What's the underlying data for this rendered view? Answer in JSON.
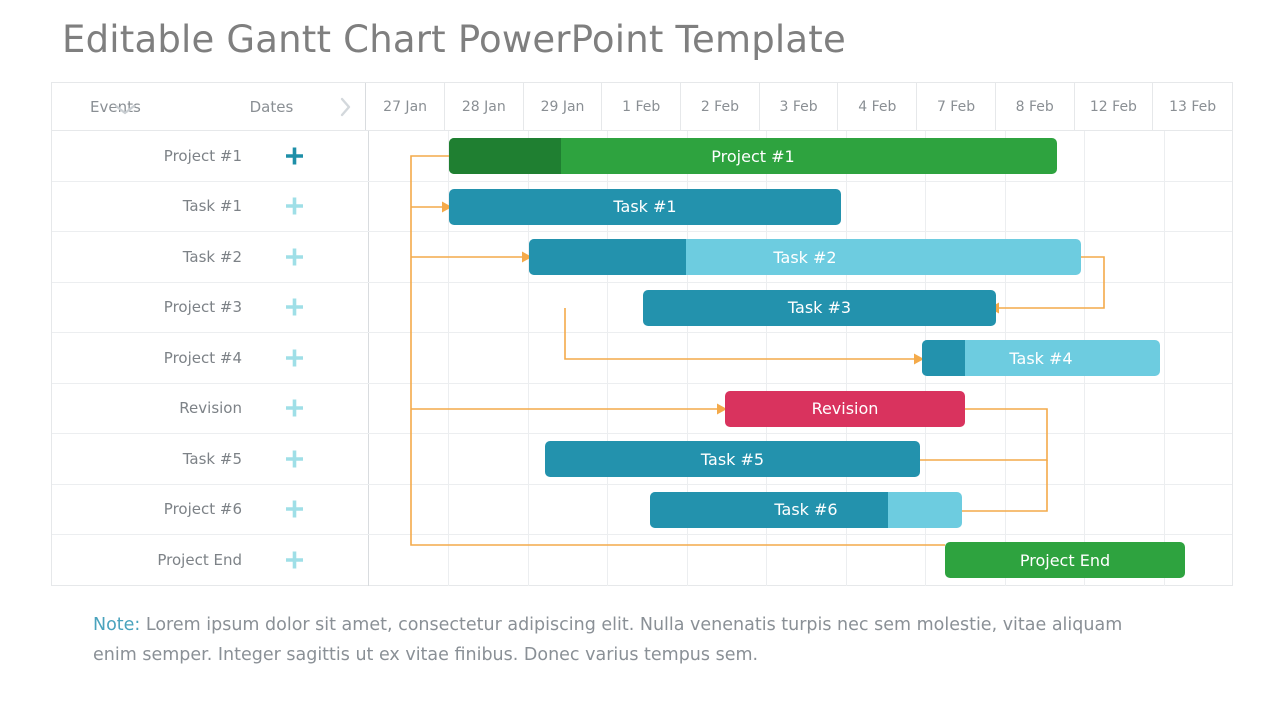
{
  "title": "Editable Gantt Chart PowerPoint Template",
  "header": {
    "events_label": "Events",
    "dates_label": "Dates",
    "collapse_icon": "chevron-down-icon",
    "expand_icon": "chevron-right-icon",
    "dates": [
      "27 Jan",
      "28 Jan",
      "29 Jan",
      "1 Feb",
      "2 Feb",
      "3 Feb",
      "4 Feb",
      "7 Feb",
      "8 Feb",
      "12 Feb",
      "13 Feb"
    ]
  },
  "rows": [
    {
      "event": "Project #1",
      "bar_label": "Project #1"
    },
    {
      "event": "Task #1",
      "bar_label": "Task #1"
    },
    {
      "event": "Task #2",
      "bar_label": "Task #2"
    },
    {
      "event": "Project #3",
      "bar_label": "Task #3"
    },
    {
      "event": "Project #4",
      "bar_label": "Task #4"
    },
    {
      "event": "Revision",
      "bar_label": "Revision"
    },
    {
      "event": "Task #5",
      "bar_label": "Task #5"
    },
    {
      "event": "Project #6",
      "bar_label": "Task #6"
    },
    {
      "event": "Project End",
      "bar_label": "Project End"
    }
  ],
  "note": {
    "keyword": "Note:",
    "text": " Lorem ipsum dolor sit amet, consectetur adipiscing elit. Nulla venenatis turpis nec sem molestie, vitae aliquam enim semper. Integer sagittis ut ex vitae finibus. Donec varius tempus sem."
  },
  "colors": {
    "green_dark": "#1f7f31",
    "green": "#2ea33f",
    "teal_dark": "#2392ad",
    "teal_light": "#6dcce0",
    "pink": "#d9335e",
    "connector": "#f4aa4a",
    "grid": "#eceef0",
    "text_grey": "#7d8287"
  },
  "chart_data": {
    "type": "bar",
    "title": "Editable Gantt Chart PowerPoint Template",
    "xlabel": "",
    "ylabel": "",
    "categories": [
      "27 Jan",
      "28 Jan",
      "29 Jan",
      "1 Feb",
      "2 Feb",
      "3 Feb",
      "4 Feb",
      "7 Feb",
      "8 Feb",
      "12 Feb",
      "13 Feb"
    ],
    "tasks": [
      {
        "name": "Project #1",
        "label": "Project #1",
        "start": "28 Jan",
        "end": "8 Feb",
        "progress_pct": 18,
        "color": "#2ea33f",
        "progress_color": "#1f7f31"
      },
      {
        "name": "Task #1",
        "label": "Task #1",
        "start": "28 Jan",
        "end": "3 Feb",
        "progress_pct": 100,
        "color": "#2392ad",
        "progress_color": "#2392ad"
      },
      {
        "name": "Task #2",
        "label": "Task #2",
        "start": "29 Jan",
        "end": "9 Feb",
        "progress_pct": 28,
        "color": "#6dcce0",
        "progress_color": "#2392ad"
      },
      {
        "name": "Task #3",
        "label": "Task #3",
        "start": "1 Feb",
        "end": "8 Feb",
        "progress_pct": 100,
        "color": "#2392ad",
        "progress_color": "#2392ad"
      },
      {
        "name": "Task #4",
        "label": "Task #4",
        "start": "7 Feb",
        "end": "13 Feb",
        "progress_pct": 18,
        "color": "#6dcce0",
        "progress_color": "#2392ad"
      },
      {
        "name": "Revision",
        "label": "Revision",
        "start": "3 Feb",
        "end": "7 Feb",
        "progress_pct": 100,
        "color": "#d9335e",
        "progress_color": "#d9335e"
      },
      {
        "name": "Task #5",
        "label": "Task #5",
        "start": "29 Jan",
        "end": "7 Feb",
        "progress_pct": 100,
        "color": "#2392ad",
        "progress_color": "#2392ad"
      },
      {
        "name": "Task #6",
        "label": "Task #6",
        "start": "1 Feb",
        "end": "8 Feb",
        "progress_pct": 75,
        "color": "#6dcce0",
        "progress_color": "#2392ad"
      },
      {
        "name": "Project End",
        "label": "Project End",
        "start": "8 Feb",
        "end": "13 Feb",
        "progress_pct": 100,
        "color": "#2ea33f",
        "progress_color": "#2ea33f"
      }
    ],
    "dependencies": [
      {
        "from": "Project #1",
        "to": "Task #1"
      },
      {
        "from": "Project #1",
        "to": "Task #2"
      },
      {
        "from": "Project #1",
        "to": "Revision"
      },
      {
        "from": "Project #1",
        "to": "Project End"
      },
      {
        "from": "Task #2",
        "to": "Task #3"
      },
      {
        "from": "Task #3",
        "to": "Task #4"
      },
      {
        "from": "Revision",
        "to": "Task #5"
      },
      {
        "from": "Revision",
        "to": "Task #6"
      }
    ],
    "grid": true,
    "legend": "none"
  }
}
